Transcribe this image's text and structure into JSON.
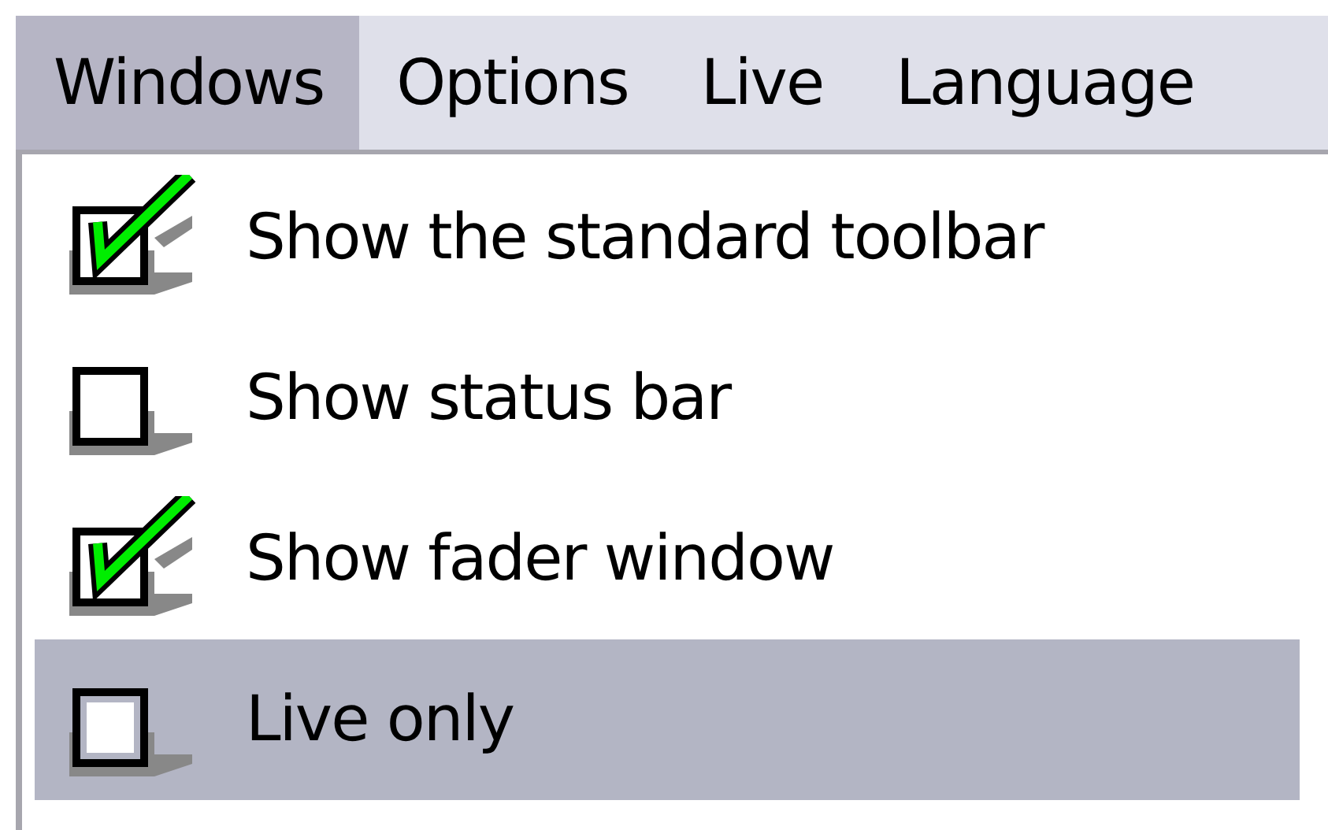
{
  "menubar": [
    {
      "label": "Windows",
      "selected": true
    },
    {
      "label": "Options",
      "selected": false
    },
    {
      "label": "Live",
      "selected": false
    },
    {
      "label": "Language",
      "selected": false
    }
  ],
  "menu": {
    "items": [
      {
        "label": "Show the standard toolbar",
        "checked": true,
        "selected": false
      },
      {
        "label": "Show status bar",
        "checked": false,
        "selected": false
      },
      {
        "label": "Show fader window",
        "checked": true,
        "selected": false
      },
      {
        "label": "Live only",
        "checked": false,
        "selected": true
      }
    ]
  }
}
